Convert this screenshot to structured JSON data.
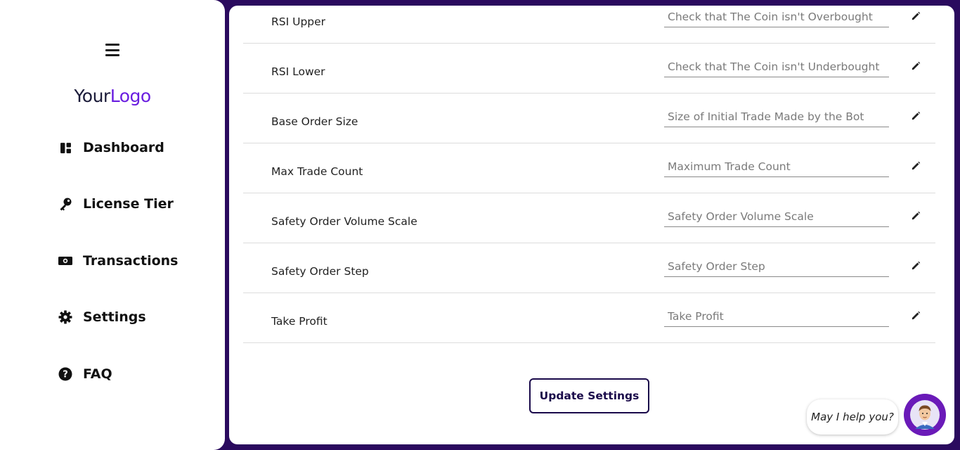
{
  "sidebar": {
    "logo": {
      "part1": "Your",
      "part2": "Logo"
    },
    "items": [
      {
        "label": "Dashboard",
        "icon": "dashboard-icon"
      },
      {
        "label": "License Tier",
        "icon": "key-icon"
      },
      {
        "label": "Transactions",
        "icon": "money-icon"
      },
      {
        "label": "Settings",
        "icon": "gear-icon"
      },
      {
        "label": "FAQ",
        "icon": "question-circle-icon"
      }
    ]
  },
  "settings": {
    "rows": [
      {
        "label": "RSI Upper",
        "placeholder": "Check that The Coin isn't Overbought"
      },
      {
        "label": "RSI Lower",
        "placeholder": "Check that The Coin isn't Underbought"
      },
      {
        "label": "Base Order Size",
        "placeholder": "Size of Initial Trade Made by the Bot"
      },
      {
        "label": "Max Trade Count",
        "placeholder": "Maximum Trade Count"
      },
      {
        "label": "Safety Order Volume Scale",
        "placeholder": "Safety Order Volume Scale"
      },
      {
        "label": "Safety Order Step",
        "placeholder": "Safety Order Step"
      },
      {
        "label": "Take Profit",
        "placeholder": "Take Profit"
      }
    ],
    "update_label": "Update Settings"
  },
  "chat": {
    "bubble_text": "May I help you?"
  },
  "colors": {
    "frame": "#2a0a5e",
    "brand": "#6a1ee0",
    "button": "#1a0a4a",
    "avatar_bg": "#6a1ab8"
  }
}
